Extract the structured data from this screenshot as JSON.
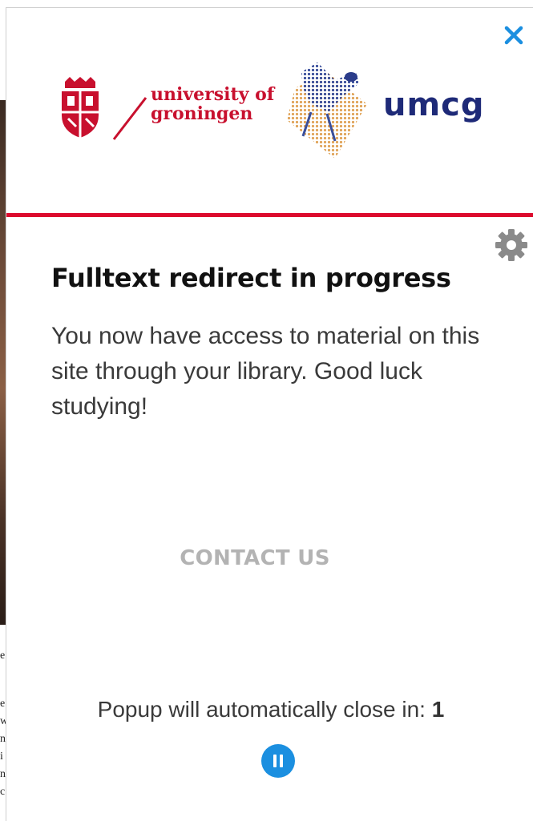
{
  "background_page": {
    "text_fragments": [
      "e",
      "e",
      "w",
      "n",
      "i",
      "n",
      "c"
    ]
  },
  "popup": {
    "logos": {
      "university_line1": "university of",
      "university_line2": "groningen",
      "umcg": "umcg"
    },
    "title": "Fulltext redirect in progress",
    "message": "You now have access to material on this site through your library. Good luck studying!",
    "contact_label": "CONTACT US",
    "countdown_label": "Popup will automatically close in:",
    "countdown_value": "1",
    "icons": {
      "close": "close-icon",
      "settings": "gear-icon",
      "pause": "pause-icon"
    },
    "colors": {
      "accent_red": "#dc0a2d",
      "umcg_blue": "#1e2a78",
      "close_blue": "#1b8fe0",
      "pause_blue": "#1b8fe0",
      "contact_gray": "#b3b3b3",
      "gear_gray": "#8a8a8a"
    }
  }
}
